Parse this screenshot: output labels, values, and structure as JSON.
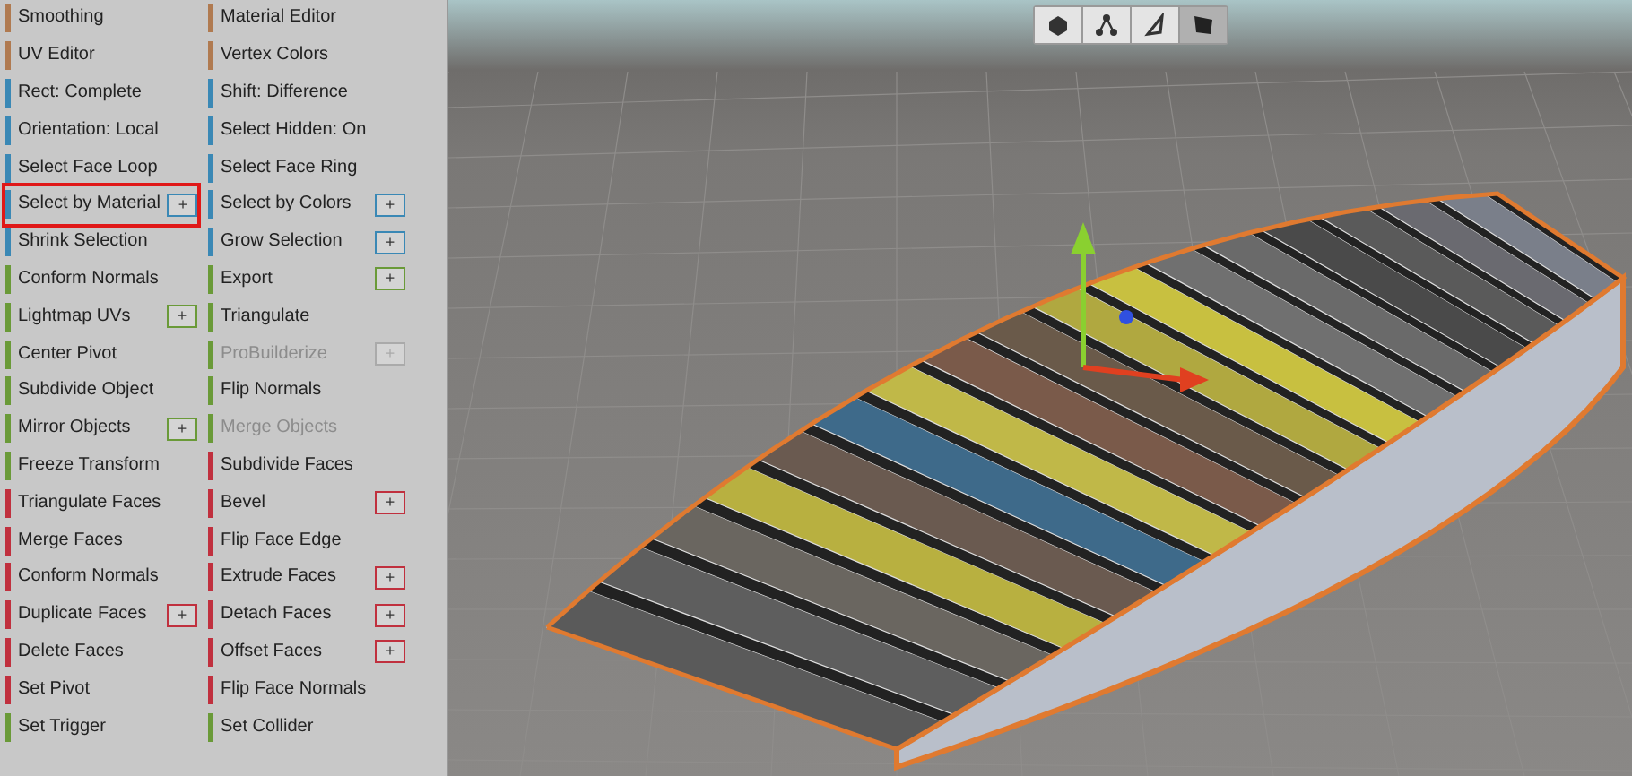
{
  "tool_panel": {
    "columns": [
      [
        {
          "label": "Smoothing",
          "color": "#b07a50",
          "disabled": false,
          "highlighted": false
        },
        {
          "label": "UV Editor",
          "color": "#b07a50",
          "disabled": false,
          "highlighted": false
        },
        {
          "label": "Rect: Complete",
          "color": "#3a88b5",
          "disabled": false,
          "highlighted": false
        },
        {
          "label": "Orientation: Local",
          "color": "#3a88b5",
          "disabled": false,
          "highlighted": false
        },
        {
          "label": "Select Face Loop",
          "color": "#3a88b5",
          "disabled": false,
          "highlighted": false
        },
        {
          "label": "Select by Material",
          "color": "#3a88b5",
          "disabled": false,
          "highlighted": true,
          "options": "+"
        },
        {
          "label": "Shrink Selection",
          "color": "#3a88b5",
          "disabled": false,
          "highlighted": false
        },
        {
          "label": "Conform Normals",
          "color": "#6a9a38",
          "disabled": false,
          "highlighted": false
        },
        {
          "label": "Lightmap UVs",
          "color": "#6a9a38",
          "disabled": false,
          "highlighted": false,
          "options": "+"
        },
        {
          "label": "Center Pivot",
          "color": "#6a9a38",
          "disabled": false,
          "highlighted": false
        },
        {
          "label": "Subdivide Object",
          "color": "#6a9a38",
          "disabled": false,
          "highlighted": false
        },
        {
          "label": "Mirror Objects",
          "color": "#6a9a38",
          "disabled": false,
          "highlighted": false,
          "options": "+"
        },
        {
          "label": "Freeze Transform",
          "color": "#6a9a38",
          "disabled": false,
          "highlighted": false
        },
        {
          "label": "Triangulate Faces",
          "color": "#c0303e",
          "disabled": false,
          "highlighted": false
        },
        {
          "label": "Merge Faces",
          "color": "#c0303e",
          "disabled": false,
          "highlighted": false
        },
        {
          "label": "Conform Normals",
          "color": "#c0303e",
          "disabled": false,
          "highlighted": false
        },
        {
          "label": "Duplicate Faces",
          "color": "#c0303e",
          "disabled": false,
          "highlighted": false,
          "options": "+"
        },
        {
          "label": "Delete Faces",
          "color": "#c0303e",
          "disabled": false,
          "highlighted": false
        },
        {
          "label": "Set Pivot",
          "color": "#c0303e",
          "disabled": false,
          "highlighted": false
        },
        {
          "label": "Set Trigger",
          "color": "#6a9a38",
          "disabled": false,
          "highlighted": false
        }
      ],
      [
        {
          "label": "Material Editor",
          "color": "#b07a50",
          "disabled": false,
          "highlighted": false
        },
        {
          "label": "Vertex Colors",
          "color": "#b07a50",
          "disabled": false,
          "highlighted": false
        },
        {
          "label": "Shift: Difference",
          "color": "#3a88b5",
          "disabled": false,
          "highlighted": false
        },
        {
          "label": "Select Hidden: On",
          "color": "#3a88b5",
          "disabled": false,
          "highlighted": false
        },
        {
          "label": "Select Face Ring",
          "color": "#3a88b5",
          "disabled": false,
          "highlighted": false
        },
        {
          "label": "Select by Colors",
          "color": "#3a88b5",
          "disabled": false,
          "highlighted": false,
          "options": "+"
        },
        {
          "label": "Grow Selection",
          "color": "#3a88b5",
          "disabled": false,
          "highlighted": false,
          "options": "+"
        },
        {
          "label": "Export",
          "color": "#6a9a38",
          "disabled": false,
          "highlighted": false,
          "options": "+"
        },
        {
          "label": "Triangulate",
          "color": "#6a9a38",
          "disabled": false,
          "highlighted": false
        },
        {
          "label": "ProBuilderize",
          "color": "#6a9a38",
          "disabled": true,
          "highlighted": false,
          "options": "+"
        },
        {
          "label": "Flip Normals",
          "color": "#6a9a38",
          "disabled": false,
          "highlighted": false
        },
        {
          "label": "Merge Objects",
          "color": "#6a9a38",
          "disabled": true,
          "highlighted": false
        },
        {
          "label": "Subdivide Faces",
          "color": "#c0303e",
          "disabled": false,
          "highlighted": false
        },
        {
          "label": "Bevel",
          "color": "#c0303e",
          "disabled": false,
          "highlighted": false,
          "options": "+"
        },
        {
          "label": "Flip Face Edge",
          "color": "#c0303e",
          "disabled": false,
          "highlighted": false
        },
        {
          "label": "Extrude Faces",
          "color": "#c0303e",
          "disabled": false,
          "highlighted": false,
          "options": "+"
        },
        {
          "label": "Detach Faces",
          "color": "#c0303e",
          "disabled": false,
          "highlighted": false,
          "options": "+"
        },
        {
          "label": "Offset Faces",
          "color": "#c0303e",
          "disabled": false,
          "highlighted": false,
          "options": "+"
        },
        {
          "label": "Flip Face Normals",
          "color": "#c0303e",
          "disabled": false,
          "highlighted": false
        },
        {
          "label": "Set Collider",
          "color": "#6a9a38",
          "disabled": false,
          "highlighted": false
        }
      ]
    ]
  },
  "viewport": {
    "edit_modes": [
      {
        "kind": "object",
        "selected": false
      },
      {
        "kind": "vertex",
        "selected": false
      },
      {
        "kind": "edge",
        "selected": false
      },
      {
        "kind": "face",
        "selected": true
      }
    ]
  }
}
